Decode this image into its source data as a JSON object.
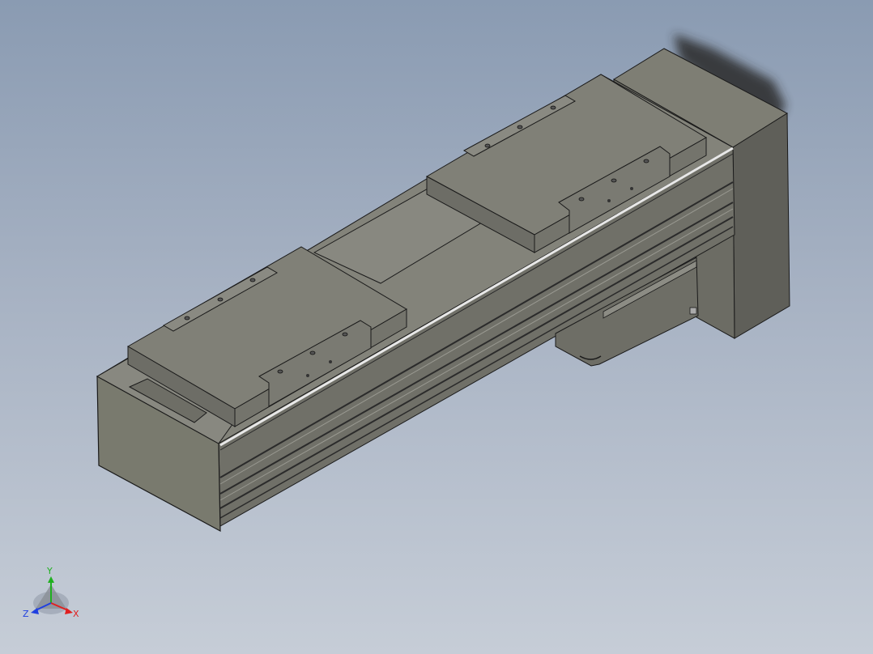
{
  "viewport": {
    "background_top": "#8a9bb2",
    "background_bottom": "#c6cdd7"
  },
  "model": {
    "body_color": "#7b7b70",
    "carriage_color": "#7f7f76",
    "edge_color": "#1a1a1a"
  },
  "triad": {
    "x_label": "X",
    "y_label": "Y",
    "z_label": "Z",
    "x_color": "#e02020",
    "y_color": "#20b020",
    "z_color": "#2040e0"
  }
}
